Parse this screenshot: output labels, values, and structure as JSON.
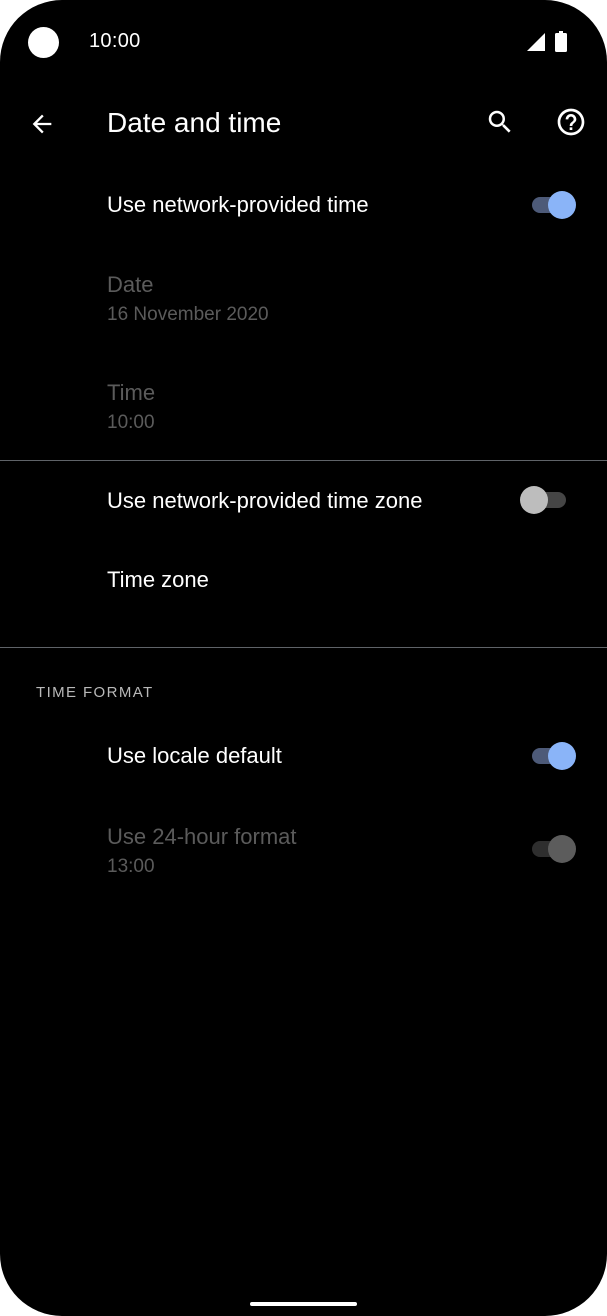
{
  "status_bar": {
    "time": "10:00",
    "icons": [
      "camera-cutout",
      "signal-icon",
      "battery-icon"
    ]
  },
  "app_bar": {
    "title": "Date and time",
    "back_icon": "arrow-back-icon",
    "search_icon": "search-icon",
    "help_icon": "help-icon"
  },
  "settings": {
    "network_time": {
      "label": "Use network-provided time",
      "enabled": true,
      "checked": true
    },
    "date": {
      "label": "Date",
      "value": "16 November 2020",
      "enabled": false
    },
    "time": {
      "label": "Time",
      "value": "10:00",
      "enabled": false
    },
    "network_time_zone": {
      "label": "Use network-provided time zone",
      "enabled": true,
      "checked": false
    },
    "time_zone": {
      "label": "Time zone",
      "enabled": true
    }
  },
  "time_format": {
    "header": "TIME FORMAT",
    "locale_default": {
      "label": "Use locale default",
      "enabled": true,
      "checked": true
    },
    "hour_24": {
      "label": "Use 24-hour format",
      "value": "13:00",
      "enabled": false,
      "checked": true
    }
  },
  "colors": {
    "background": "#000000",
    "accent": "#8ab4f8",
    "text_primary": "#ffffff",
    "text_disabled": "#5b5b5b"
  }
}
